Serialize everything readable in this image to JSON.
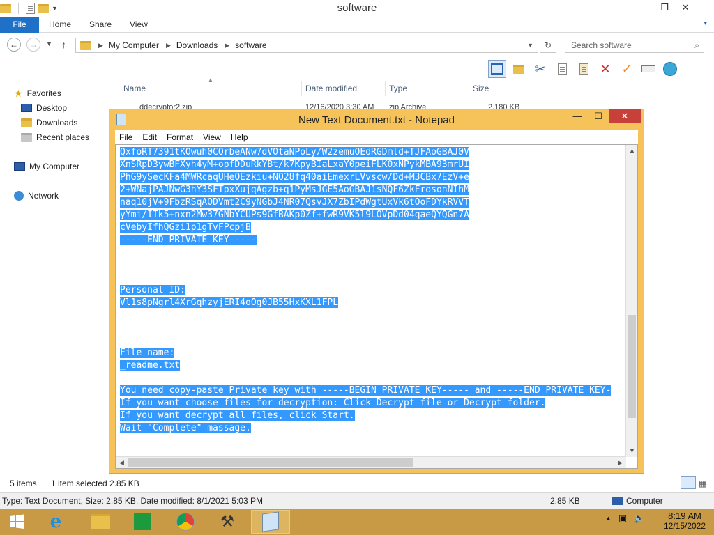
{
  "explorer": {
    "title": "software",
    "ribbon_tabs": [
      "File",
      "Home",
      "Share",
      "View"
    ],
    "path": [
      "My Computer",
      "Downloads",
      "software"
    ],
    "search_placeholder": "Search software",
    "nav": {
      "favorites": "Favorites",
      "desktop": "Desktop",
      "downloads": "Downloads",
      "recent": "Recent places",
      "computer": "My Computer",
      "network": "Network"
    },
    "columns": [
      "Name",
      "Date modified",
      "Type",
      "Size"
    ],
    "partial_row": {
      "name": "ddecryptor2.zip",
      "date": "12/16/2020 3:30 AM",
      "type": "zip Archive",
      "size": "2,180 KB"
    },
    "status": {
      "items": "5 items",
      "selected": "1 item selected  2.85 KB"
    },
    "details": {
      "info": "Type: Text Document, Size: 2.85 KB, Date modified: 8/1/2021 5:03 PM",
      "size": "2.85 KB",
      "location": "Computer"
    }
  },
  "notepad": {
    "title": "New Text Document.txt - Notepad",
    "menu": [
      "File",
      "Edit",
      "Format",
      "View",
      "Help"
    ],
    "lines": [
      "QxfoRT7391tKOwuh0CQrbeANw7dVOtaNPoLy/W2zemuOEdRGDmld+TJFAoGBAJ0V",
      "XnSRpD3ywBFXyh4yM+opfDDuRkYBt/k7KpyBIaLxaY0peiFLK0xNPykMBA93mrUI",
      "PhG9ySecKFa4MWRcaqUHeOEzkiu+NQ28fq40aiEmexrLVvscw/Dd+M3CBx7EzV+e",
      "2+WNajPAJNwG3hY3SFTpxXujqAgzb+q1PyMsJGE5AoGBAJ1sNQF6ZkFrosonNIhM",
      "naq10jV+9FbzRSqAODVmt2C9yNGbJ4NR07QsvJX7ZbIPdWgtUxVk6tOoFDYkRVVT",
      "yYmi/ITk5+nxn2Mw37GNbYCUPs9GfBAKp0Zf+fwR9VK5l9LOVpDd04qaeQYQGn7A",
      "cVebyIfhQGzi1p1gTvFPcpjB",
      "-----END PRIVATE KEY-----",
      "",
      "",
      "",
      "Personal ID:",
      "Vl1s8pNgrl4XrGqhzyjERI4oOg0JB55HxKXL1FPL",
      "",
      "",
      "",
      "File name:",
      "_readme.txt",
      "",
      "You need copy-paste Private key with -----BEGIN PRIVATE KEY----- and -----END PRIVATE KEY-",
      "If you want choose files for decryption: Click Decrypt file or Decrypt folder.",
      "If you want decrypt all files, click Start.",
      "Wait \"Complete\" massage.",
      ""
    ]
  },
  "taskbar": {
    "time": "8:19 AM",
    "date": "12/15/2022"
  }
}
